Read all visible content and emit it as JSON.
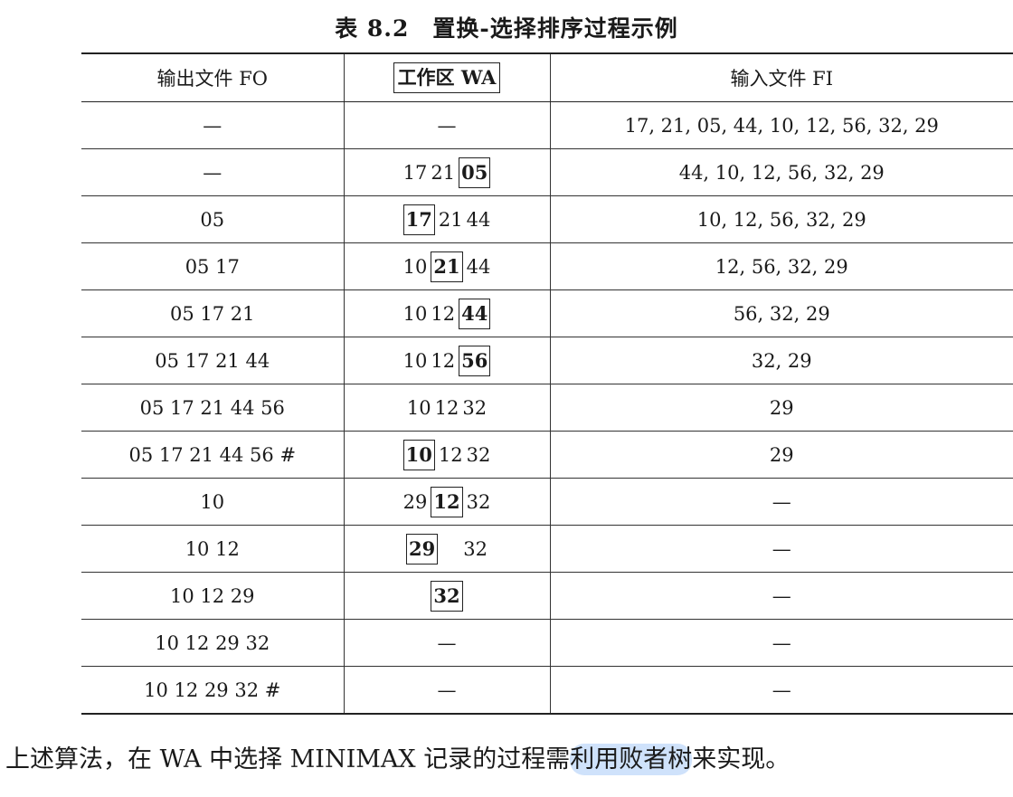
{
  "caption": {
    "number": "表 8.2",
    "title": "置换-选择排序过程示例"
  },
  "table": {
    "headers": {
      "fo": "输出文件 FO",
      "wa": "工作区 WA",
      "fi": "输入文件 FI"
    },
    "rows": [
      {
        "fo": "—",
        "wa": [
          {
            "v": "—"
          }
        ],
        "fi": "17, 21, 05, 44, 10, 12, 56, 32, 29"
      },
      {
        "fo": "—",
        "wa": [
          {
            "v": "17"
          },
          {
            "v": "21"
          },
          {
            "v": "05",
            "sel": true
          }
        ],
        "fi": "44, 10, 12, 56, 32, 29"
      },
      {
        "fo": "05",
        "wa": [
          {
            "v": "17",
            "sel": true
          },
          {
            "v": "21"
          },
          {
            "v": "44"
          }
        ],
        "fi": "10, 12, 56, 32, 29"
      },
      {
        "fo": "05 17",
        "wa": [
          {
            "v": "10"
          },
          {
            "v": "21",
            "sel": true
          },
          {
            "v": "44"
          }
        ],
        "fi": "12, 56, 32, 29"
      },
      {
        "fo": "05 17 21",
        "wa": [
          {
            "v": "10"
          },
          {
            "v": "12"
          },
          {
            "v": "44",
            "sel": true
          }
        ],
        "fi": "56, 32, 29"
      },
      {
        "fo": "05 17 21 44",
        "wa": [
          {
            "v": "10"
          },
          {
            "v": "12"
          },
          {
            "v": "56",
            "sel": true
          }
        ],
        "fi": "32, 29"
      },
      {
        "fo": "05 17 21 44 56",
        "wa": [
          {
            "v": "10"
          },
          {
            "v": "12"
          },
          {
            "v": "32"
          }
        ],
        "fi": "29"
      },
      {
        "fo": "05 17 21 44 56 #",
        "wa": [
          {
            "v": "10",
            "sel": true
          },
          {
            "v": "12"
          },
          {
            "v": "32"
          }
        ],
        "fi": "29"
      },
      {
        "fo": "10",
        "wa": [
          {
            "v": "29"
          },
          {
            "v": "12",
            "sel": true
          },
          {
            "v": "32"
          }
        ],
        "fi": "—"
      },
      {
        "fo": "10 12",
        "wa": [
          {
            "v": "29",
            "sel": true
          },
          {
            "v": "32",
            "gap": true
          }
        ],
        "fi": "—"
      },
      {
        "fo": "10 12 29",
        "wa": [
          {
            "v": "32",
            "sel": true
          }
        ],
        "fi": "—"
      },
      {
        "fo": "10 12 29 32",
        "wa": [
          {
            "v": "—"
          }
        ],
        "fi": "—"
      },
      {
        "fo": "10 12 29 32 #",
        "wa": [
          {
            "v": "—"
          }
        ],
        "fi": "—"
      }
    ]
  },
  "footer": {
    "before": "上述算法，在 WA 中选择 MINIMAX 记录的过程需",
    "highlighted": "利用败者树",
    "after": "来实现。"
  }
}
